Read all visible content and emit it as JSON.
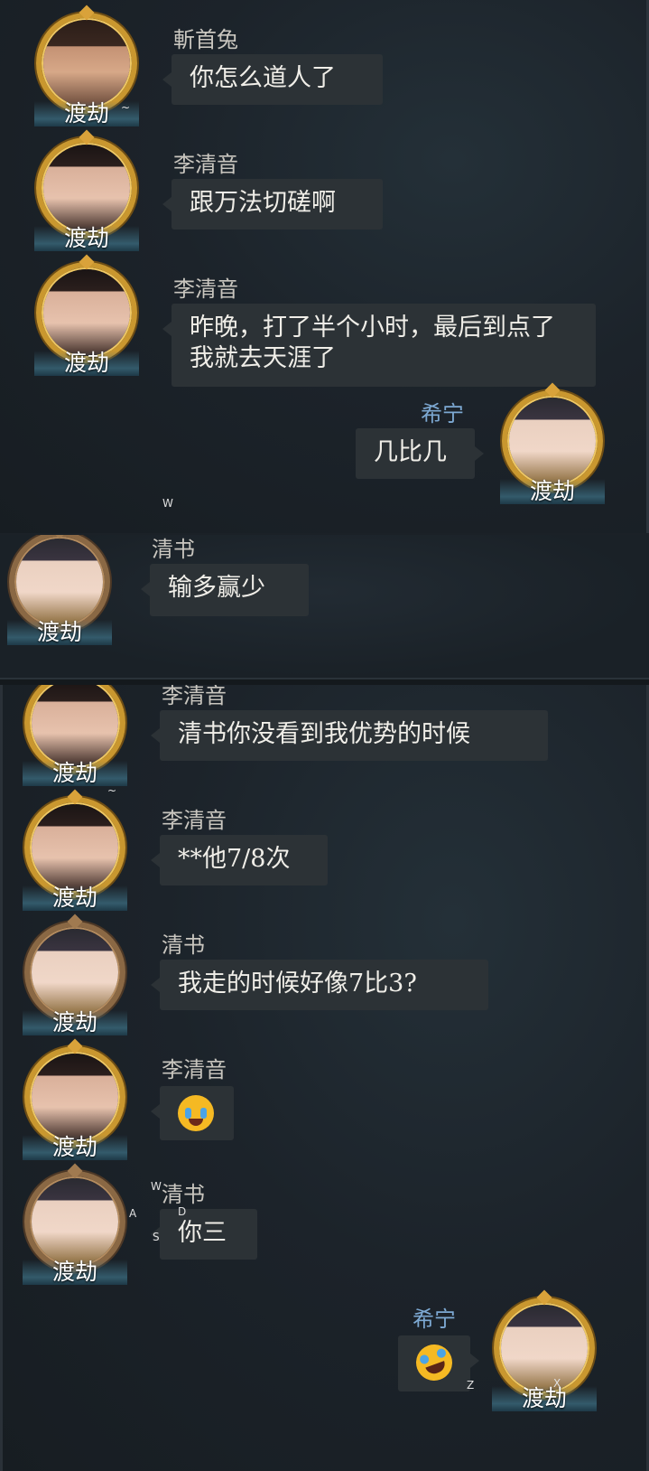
{
  "rank_label": "渡劫",
  "marks": {
    "w1": "W",
    "tilde1": "~",
    "tilde2": "~",
    "w2": "W",
    "a": "A",
    "d": "D",
    "s": "S",
    "z": "Z",
    "x": "X"
  },
  "messages": [
    {
      "sender": "斬首兔",
      "text": "你怎么道人了"
    },
    {
      "sender": "李清音",
      "text": "跟万法切磋啊"
    },
    {
      "sender": "李清音",
      "text": "昨晚，打了半个小时，最后到点了我就去天涯了"
    },
    {
      "sender": "希宁",
      "text": "几比几"
    },
    {
      "sender": "清书",
      "text": "输多赢少"
    },
    {
      "sender": "李清音",
      "text": "清书你没看到我优势的时候"
    },
    {
      "sender": "李清音",
      "text": "**他7/8次"
    },
    {
      "sender": "清书",
      "text": "我走的时候好像7比3?"
    },
    {
      "sender": "李清音",
      "emoji": "loudly-crying-face"
    },
    {
      "sender": "清书",
      "text": "你三"
    },
    {
      "sender": "希宁",
      "emoji": "rolling-on-floor-laughing-face"
    }
  ],
  "colors": {
    "bubble": "#2c3236",
    "self_name": "#7da9d3",
    "gold_ring": "#c9972f"
  }
}
